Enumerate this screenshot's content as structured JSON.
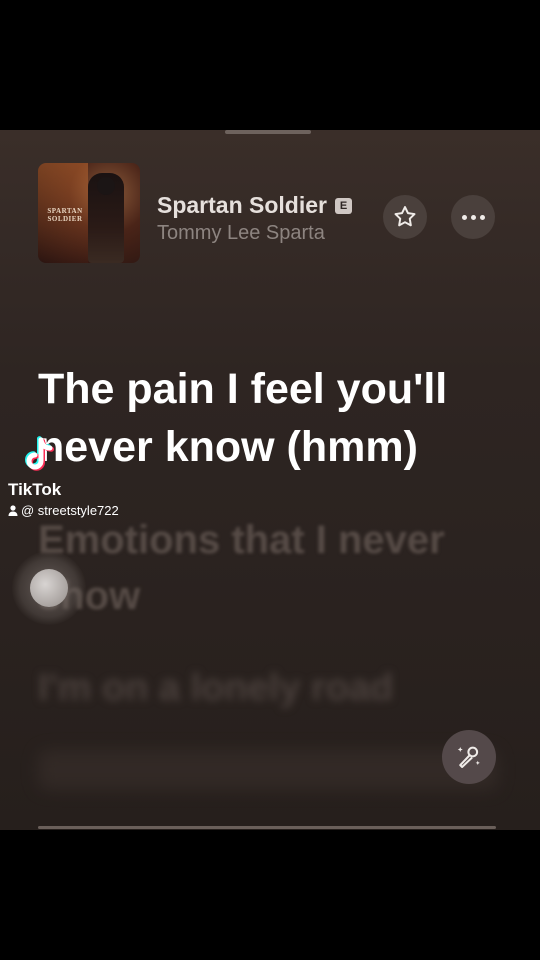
{
  "now_playing": {
    "title": "Spartan Soldier",
    "explicit_badge": "E",
    "artist": "Tommy Lee Sparta",
    "album_art_text": "SPARTAN SOLDIER"
  },
  "lyrics": {
    "active": "The pain I feel you'll never know (hmm)",
    "next": "Emotions that I never show",
    "later": "I'm on a lonely road"
  },
  "overlay": {
    "brand": "TikTok",
    "handle": "@ streetstyle722"
  },
  "icons": {
    "favorite": "star-icon",
    "more": "ellipsis-icon",
    "sing": "microphone-sparkle-icon",
    "user": "user-icon"
  },
  "colors": {
    "background": "#2e2522",
    "active_lyric": "#ffffff",
    "dim_lyric": "#564b46"
  }
}
